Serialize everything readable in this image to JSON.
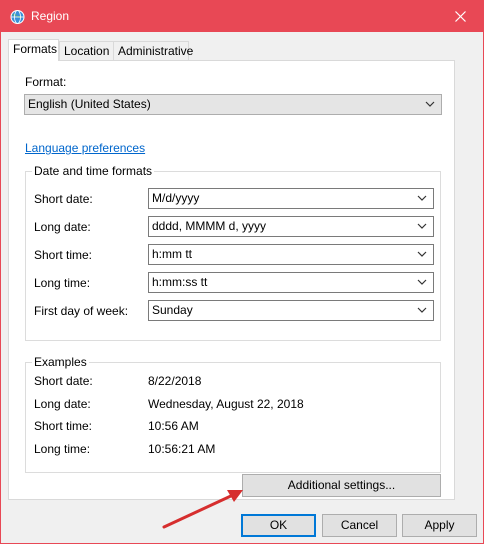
{
  "window": {
    "title": "Region",
    "accent": "#e84855"
  },
  "tabs": [
    {
      "label": "Formats",
      "active": true
    },
    {
      "label": "Location",
      "active": false
    },
    {
      "label": "Administrative",
      "active": false
    }
  ],
  "format": {
    "label": "Format:",
    "value": "English (United States)"
  },
  "language_link": "Language preferences",
  "date_time_formats": {
    "title": "Date and time formats",
    "rows": [
      {
        "label": "Short date:",
        "value": "M/d/yyyy"
      },
      {
        "label": "Long date:",
        "value": "dddd, MMMM d, yyyy"
      },
      {
        "label": "Short time:",
        "value": "h:mm tt"
      },
      {
        "label": "Long time:",
        "value": "h:mm:ss tt"
      },
      {
        "label": "First day of week:",
        "value": "Sunday"
      }
    ]
  },
  "examples": {
    "title": "Examples",
    "rows": [
      {
        "label": "Short date:",
        "value": "8/22/2018"
      },
      {
        "label": "Long date:",
        "value": "Wednesday, August 22, 2018"
      },
      {
        "label": "Short time:",
        "value": "10:56 AM"
      },
      {
        "label": "Long time:",
        "value": "10:56:21 AM"
      }
    ]
  },
  "buttons": {
    "additional_settings": "Additional settings...",
    "ok": "OK",
    "cancel": "Cancel",
    "apply": "Apply"
  },
  "icons": {
    "title": "globe-icon",
    "close": "close-icon",
    "chevron": "chevron-down-icon",
    "annotation": "red-arrow-icon"
  }
}
